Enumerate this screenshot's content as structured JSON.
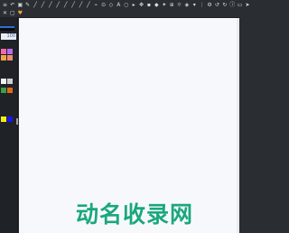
{
  "toolbar": {
    "row1_tools": [
      {
        "name": "menu-icon",
        "glyph": "≡"
      },
      {
        "name": "undo-icon",
        "glyph": "↶"
      },
      {
        "name": "image-icon",
        "glyph": "▣"
      },
      {
        "name": "pencil-icon",
        "glyph": "✎"
      },
      {
        "name": "pen-icon",
        "glyph": "╱"
      },
      {
        "name": "brush-icon",
        "glyph": "╱"
      },
      {
        "name": "marker-icon",
        "glyph": "╱"
      },
      {
        "name": "airbrush-icon",
        "glyph": "╱"
      },
      {
        "name": "calligraphy-icon",
        "glyph": "╱"
      },
      {
        "name": "ink-icon",
        "glyph": "╱"
      },
      {
        "name": "chalk-icon",
        "glyph": "╱"
      },
      {
        "name": "spray-icon",
        "glyph": "╱"
      },
      {
        "name": "dropper-icon",
        "glyph": "⌁"
      },
      {
        "name": "mixer-icon",
        "glyph": "⊙"
      },
      {
        "name": "eraser-icon",
        "glyph": "◇"
      },
      {
        "name": "text-icon",
        "glyph": "A"
      },
      {
        "name": "lasso-icon",
        "glyph": "○"
      },
      {
        "name": "select-icon",
        "glyph": "▸"
      },
      {
        "name": "move-icon",
        "glyph": "✥"
      },
      {
        "name": "layer-icon",
        "glyph": "▪"
      },
      {
        "name": "shape-icon",
        "glyph": "◆"
      },
      {
        "name": "magic-icon",
        "glyph": "✦"
      },
      {
        "name": "zoom-icon",
        "glyph": "⊕"
      },
      {
        "name": "brightness-icon",
        "glyph": "☼"
      },
      {
        "name": "bucket-icon",
        "glyph": "◈"
      },
      {
        "name": "filter-icon",
        "glyph": "▾"
      },
      {
        "name": "grid-icon",
        "glyph": "⋮"
      },
      {
        "name": "settings-icon",
        "glyph": "⚙"
      },
      {
        "name": "history-icon",
        "glyph": "↺"
      },
      {
        "name": "redo-icon",
        "glyph": "↻"
      },
      {
        "name": "info-icon",
        "glyph": "ⓘ"
      },
      {
        "name": "window-icon",
        "glyph": "▭"
      },
      {
        "name": "arrow-icon",
        "glyph": "➤"
      }
    ],
    "row2_tools": [
      {
        "name": "close-icon",
        "glyph": "✕"
      },
      {
        "name": "frame-icon",
        "glyph": "▢"
      },
      {
        "name": "heart-icon",
        "glyph": "♥"
      }
    ],
    "accent_color": "#f2a33a"
  },
  "sidebar": {
    "size_value": "100",
    "swatches": [
      {
        "name": "swatch-pink",
        "color": "#f06aa8"
      },
      {
        "name": "swatch-purple",
        "color": "#b76bf2"
      },
      {
        "name": "swatch-orange",
        "color": "#f2a04a"
      },
      {
        "name": "swatch-salmon",
        "color": "#f58b6b"
      },
      {
        "name": "swatch-white",
        "color": "#f2f2f2"
      },
      {
        "name": "swatch-gray",
        "color": "#cfcfcf"
      },
      {
        "name": "swatch-green",
        "color": "#3aa04a"
      },
      {
        "name": "swatch-dark-orange",
        "color": "#e06a1a"
      },
      {
        "name": "swatch-yellow",
        "color": "#f2ee12"
      },
      {
        "name": "swatch-blue",
        "color": "#1a14f2"
      }
    ]
  },
  "canvas": {
    "background": "#f7f8fb"
  },
  "watermark": {
    "text": "动名收录网",
    "color": "#1aa87a"
  }
}
